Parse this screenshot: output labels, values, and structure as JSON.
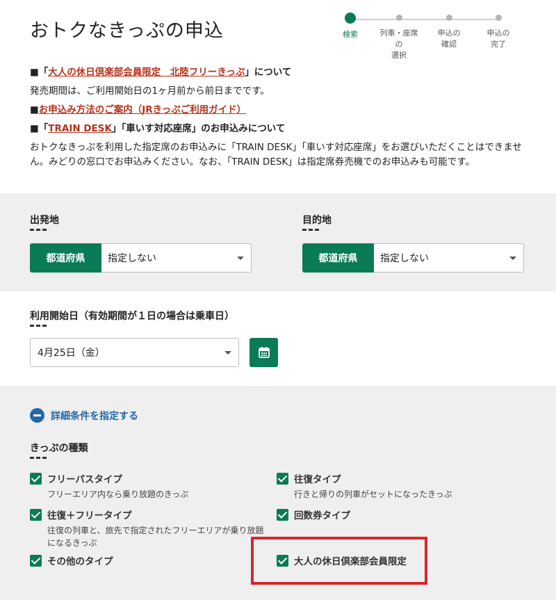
{
  "page": {
    "title": "おトクなきっぷの申込"
  },
  "stepper": {
    "steps": [
      {
        "label": "検索"
      },
      {
        "label": "列車・座席の\n選択"
      },
      {
        "label": "申込の\n確認"
      },
      {
        "label": "申込の\n完了"
      }
    ],
    "active_index": 0,
    "active_color": "#0a7b57"
  },
  "notices": {
    "n1_prefix": "■「",
    "n1_link": "大人の休日倶楽部会員限定　北陸フリーきっぷ",
    "n1_suffix": "」について",
    "n1_text": "発売期間は、ご利用開始日の1ヶ月前から前日までです。",
    "n2_prefix": "■",
    "n2_link": "お申込み方法のご案内（JRきっぷご利用ガイド）",
    "n3_prefix": "■「",
    "n3_link": "TRAIN DESK",
    "n3_suffix": "」「車いす対応座席」のお申込みについて",
    "n3_text": "おトクなきっぷを利用した指定席のお申込みに「TRAIN DESK」「車いす対応座席」をお選びいただくことはできません。みどりの窓口でお申込みください。なお、「TRAIN DESK」は指定席券売機でのお申込みも可能です。"
  },
  "departure": {
    "label": "出発地",
    "button": "都道府県",
    "value": "指定しない"
  },
  "destination": {
    "label": "目的地",
    "button": "都道府県",
    "value": "指定しない"
  },
  "start_date": {
    "label": "利用開始日（有効期間が１日の場合は乗車日）",
    "value": "4月25日（金）"
  },
  "detail_toggle": {
    "label": "詳細条件を指定する"
  },
  "ticket_types": {
    "label": "きっぷの種類",
    "items": [
      {
        "label": "フリーパスタイプ",
        "desc": "フリーエリア内なら乗り放題のきっぷ",
        "checked": true
      },
      {
        "label": "往復タイプ",
        "desc": "行きと帰りの列車がセットになったきっぷ",
        "checked": true
      },
      {
        "label": "往復＋フリータイプ",
        "desc": "往復の列車と、旅先で指定されたフリーエリアが乗り放題になるきっぷ",
        "checked": true
      },
      {
        "label": "回数券タイプ",
        "desc": "",
        "checked": true
      },
      {
        "label": "その他のタイプ",
        "desc": "",
        "checked": true
      },
      {
        "label": "大人の休日倶楽部会員限定",
        "desc": "",
        "checked": true
      }
    ]
  },
  "colors": {
    "brand_green": "#0a7b57",
    "link_red": "#b4341c",
    "accent_blue": "#2467a8",
    "highlight_red": "#d9262b"
  }
}
